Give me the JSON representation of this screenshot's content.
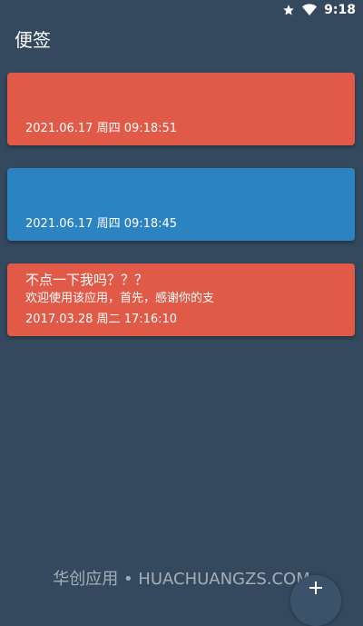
{
  "status_bar": {
    "time": "9:18",
    "icons": [
      "star-icon",
      "wifi-icon"
    ]
  },
  "app": {
    "title": "便签"
  },
  "notes": [
    {
      "title": "",
      "body": "",
      "date": "2021.06.17 周四 09:18:51",
      "color": "#e15a48"
    },
    {
      "title": "",
      "body": "",
      "date": "2021.06.17 周四 09:18:45",
      "color": "#2c83c2"
    },
    {
      "title": "不点一下我吗？？？",
      "body": "欢迎使用该应用，首先，感谢你的支",
      "date": "2017.03.28 周二 17:16:10",
      "color": "#e15a48"
    }
  ],
  "watermark": "华创应用 • HUACHUANGZS.COM",
  "fab": {
    "icon": "plus-icon"
  },
  "colors": {
    "background": "#34495e",
    "note_red": "#e15a48",
    "note_blue": "#2c83c2"
  }
}
